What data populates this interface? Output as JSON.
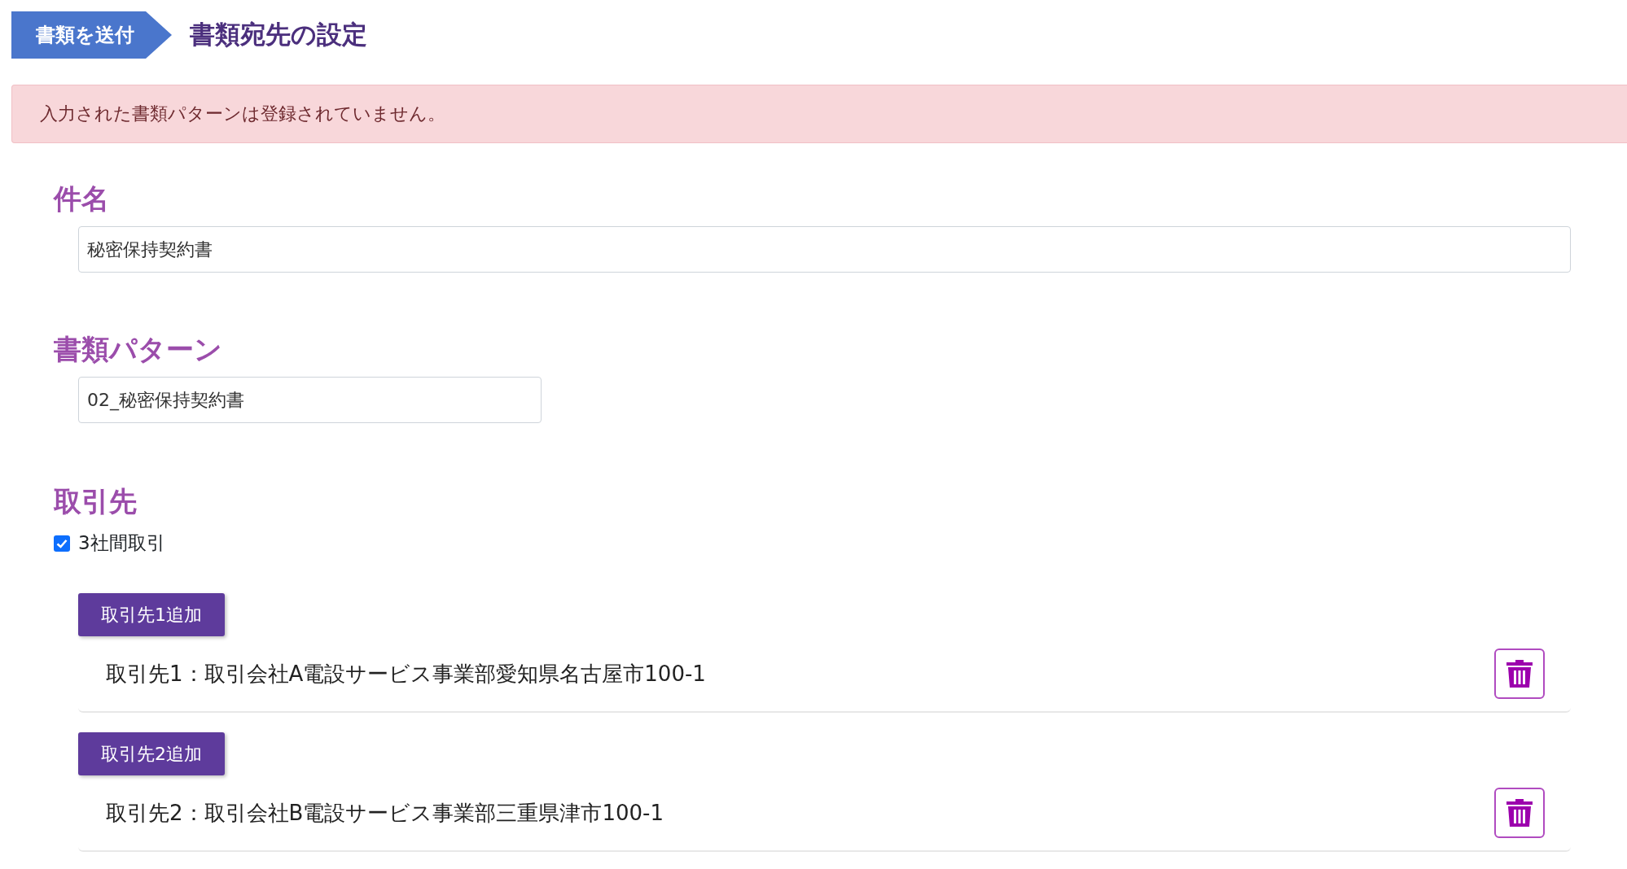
{
  "breadcrumb": {
    "step": "書類を送付",
    "title": "書類宛先の設定"
  },
  "alert": {
    "message": "入力された書類パターンは登録されていません。"
  },
  "subject": {
    "heading": "件名",
    "value": "秘密保持契約書"
  },
  "pattern": {
    "heading": "書類パターン",
    "value": "02_秘密保持契約書"
  },
  "partners": {
    "heading": "取引先",
    "three_way": {
      "label": "3社間取引",
      "checked": true
    },
    "entries": [
      {
        "button": "取引先1追加",
        "text": "取引先1：取引会社A電設サービス事業部愛知県名古屋市100-1"
      },
      {
        "button": "取引先2追加",
        "text": "取引先2：取引会社B電設サービス事業部三重県津市100-1"
      }
    ]
  }
}
